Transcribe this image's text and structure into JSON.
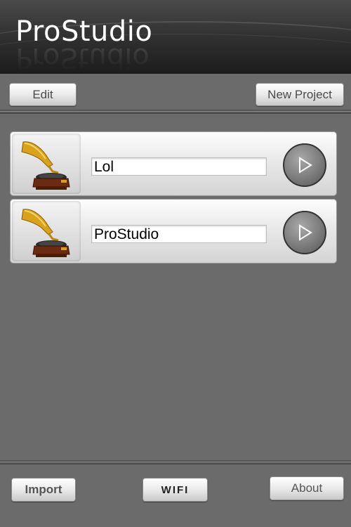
{
  "header": {
    "title": "ProStudio"
  },
  "toolbar": {
    "edit_label": "Edit",
    "new_project_label": "New Project"
  },
  "projects": [
    {
      "name": "Lol",
      "icon": "gramophone-icon"
    },
    {
      "name": "ProStudio",
      "icon": "gramophone-icon"
    }
  ],
  "footer": {
    "import_label": "Import",
    "wifi_label": "WIFI",
    "about_label": "About"
  },
  "colors": {
    "background": "#6b6b6b",
    "header_top": "#4a4a4a",
    "header_bottom": "#1c1c1c",
    "horn_gold": "#d8a21c",
    "cabinet_brown": "#6b2b12"
  }
}
